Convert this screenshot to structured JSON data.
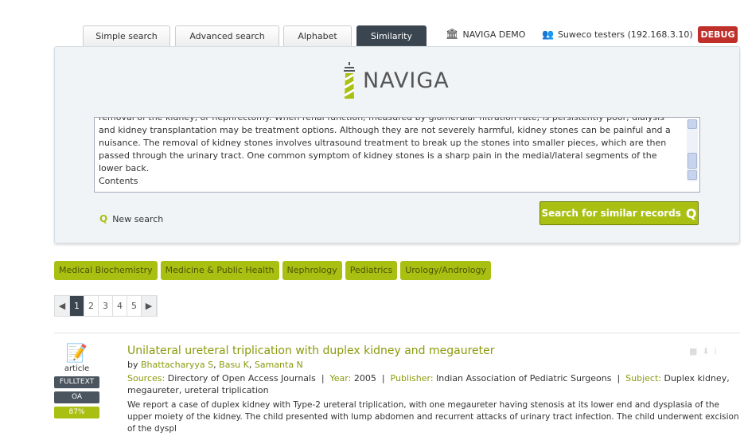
{
  "tabs": [
    {
      "label": "Simple search"
    },
    {
      "label": "Advanced search"
    },
    {
      "label": "Alphabet"
    },
    {
      "label": "Similarity",
      "active": true
    }
  ],
  "header": {
    "institution": "NAVIGA DEMO",
    "user": "Suweco testers (192.168.3.10)",
    "debug": "DEBUG"
  },
  "logo": {
    "text": "NAVIGA"
  },
  "query_text": "removal of the kidney, or nephrectomy. When renal function, measured by glomerular filtration rate, is persistently poor, dialysis and kidney transplantation may be treatment options. Although they are not severely harmful, kidney stones can be painful and a nuisance. The removal of kidney stones involves ultrasound treatment to break up the stones into smaller pieces, which are then passed through the urinary tract. One common symptom of kidney stones is a sharp pain in the medial/lateral segments of the lower back.\nContents",
  "new_search": "New search",
  "search_button": "Search for similar records",
  "tags": [
    "Medical Biochemistry",
    "Medicine & Public Health",
    "Nephrology",
    "Pediatrics",
    "Urology/Andrology"
  ],
  "pagination": {
    "pages": [
      "1",
      "2",
      "3",
      "4",
      "5"
    ],
    "current": "1"
  },
  "results": [
    {
      "type": "article",
      "badges": [
        "FULLTEXT",
        "OA",
        "87%"
      ],
      "title": "Unilateral ureteral triplication with duplex kidney and megaureter",
      "by": "by",
      "authors": [
        "Bhattacharyya S",
        "Basu K",
        "Samanta N"
      ],
      "sources_label": "Sources:",
      "sources": "Directory of Open Access Journals",
      "year_label": "Year:",
      "year": "2005",
      "publisher_label": "Publisher:",
      "publisher": "Indian Association of Pediatric Surgeons",
      "subject_label": "Subject:",
      "subject": "Duplex kidney, megaureter, ureteral triplication",
      "abstract": "We report a case of duplex kidney with Type-2 ureteral triplication, with one megaureter having stenosis at its lower end and dysplasia of the upper moiety of the kidney. The child presented with lump abdomen and recurrent attacks of urinary tract infection. The child underwent excision of the dyspl"
    }
  ],
  "colors": {
    "accent": "#a9c013",
    "dark": "#3a4550",
    "debug": "#c0302b"
  }
}
